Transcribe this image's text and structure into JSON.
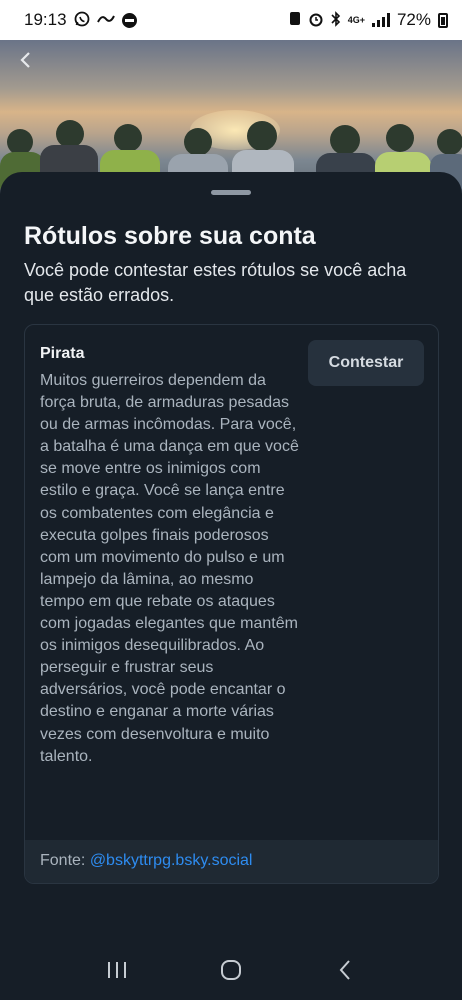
{
  "status_bar": {
    "time": "19:13",
    "network": "4G+",
    "battery_percent": "72%"
  },
  "banner": {
    "back_icon": "chevron-left-icon"
  },
  "sheet": {
    "title": "Rótulos sobre sua conta",
    "description": "Você pode contestar estes rótulos se você acha que estão errados."
  },
  "label_card": {
    "name": "Pirata",
    "description": "Muitos guerreiros dependem da força bruta, de armaduras pesadas ou de armas incômodas. Para você, a batalha é uma dança em que você se move entre os inimigos com estilo e graça. Você se lança entre os combatentes com elegância e executa golpes finais poderosos com um movimento do pulso e um lampejo da lâmina, ao mesmo tempo em que rebate os ataques com jogadas elegantes que mantêm os inimigos desequilibrados. Ao perseguir e frustrar seus adversários, você pode encantar o destino e enganar a morte várias vezes com desenvoltura e muito talento.",
    "contest_label": "Contestar",
    "source_prefix": "Fonte:",
    "source_handle": "@bskyttrpg.bsky.social"
  },
  "colors": {
    "background": "#161e27",
    "link": "#2e8cf0",
    "button_bg": "#26313d"
  }
}
